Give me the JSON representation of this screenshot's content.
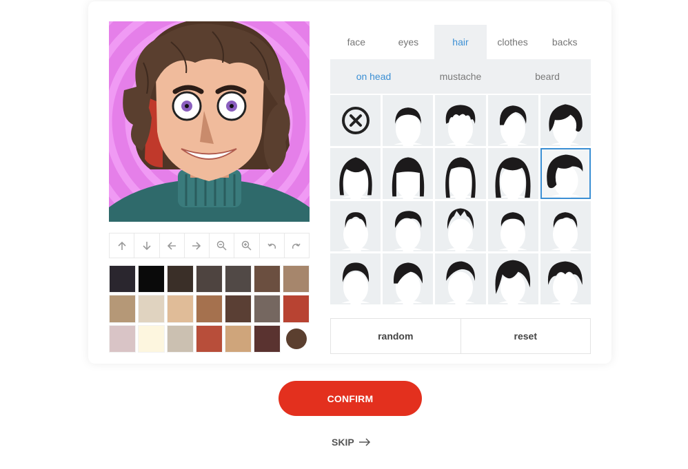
{
  "tabs": [
    {
      "label": "face"
    },
    {
      "label": "eyes"
    },
    {
      "label": "hair",
      "active": true
    },
    {
      "label": "clothes"
    },
    {
      "label": "backs"
    }
  ],
  "subtabs": [
    {
      "label": "on head",
      "active": true
    },
    {
      "label": "mustache"
    },
    {
      "label": "beard"
    }
  ],
  "toolbar": [
    "arrow-up-icon",
    "arrow-down-icon",
    "arrow-left-icon",
    "arrow-right-icon",
    "zoom-out-icon",
    "zoom-in-icon",
    "undo-icon",
    "redo-icon"
  ],
  "palette": [
    "#2a262e",
    "#0a0a0a",
    "#3a2f28",
    "#4e4440",
    "#514946",
    "#6b4f40",
    "#a6866c",
    "#b59877",
    "#e0d3c0",
    "#e0bc98",
    "#a5714e",
    "#5a3f34",
    "#756760",
    "#b84332",
    "#d9c4c6",
    "#fdf6df",
    "#cbc0b1",
    "#b84e3a",
    "#cfa57b",
    "#5a3330",
    "#5b3f2f"
  ],
  "colors": {
    "accent": "#3b8fd4",
    "confirm": "#e3301e",
    "hair": "#5a3f2f"
  },
  "hair_grid": {
    "selected_index": 9,
    "first_cell": "none-icon"
  },
  "actions": {
    "random": "random",
    "reset": "reset"
  },
  "confirm": "CONFIRM",
  "skip": "SKIP"
}
